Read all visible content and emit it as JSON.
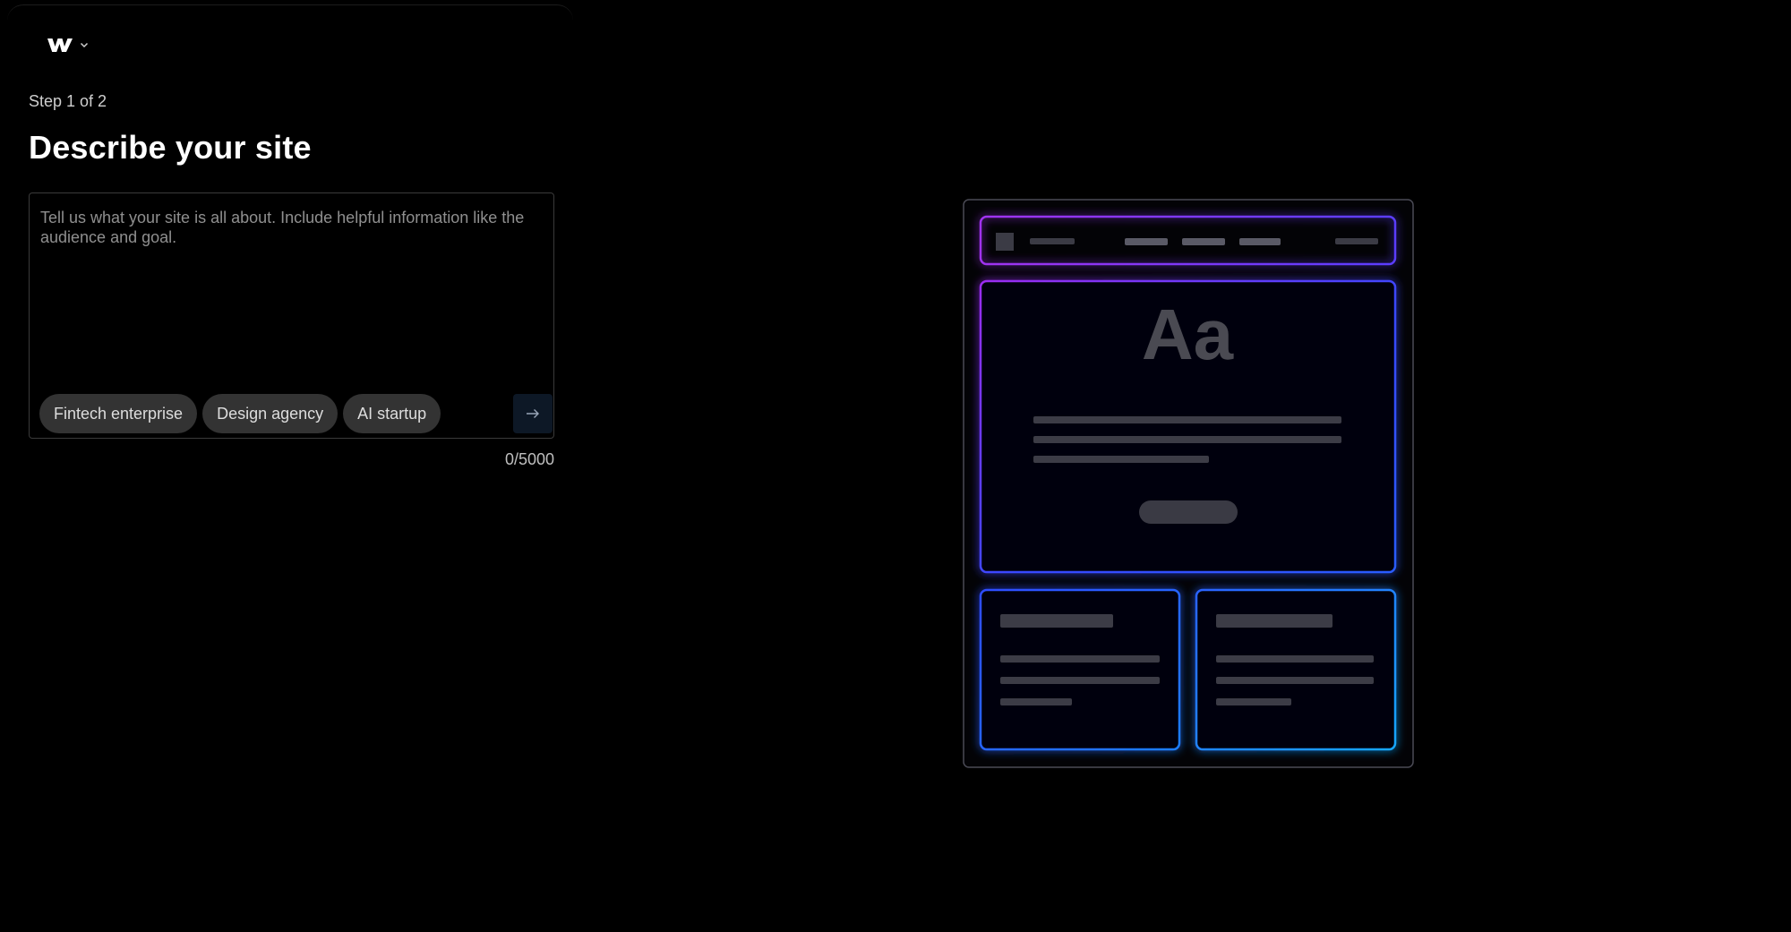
{
  "header": {
    "logo_icon": "webflow-logo-icon",
    "menu_icon": "chevron-down-icon"
  },
  "form": {
    "step": "Step 1 of 2",
    "title": "Describe your site",
    "prompt_placeholder": "Tell us what your site is all about. Include helpful information like the audience and goal.",
    "prompt_value": "",
    "suggestions": [
      {
        "label": "Fintech enterprise"
      },
      {
        "label": "Design agency"
      },
      {
        "label": "AI startup"
      }
    ],
    "submit_icon": "arrow-right-icon",
    "char_count": "0/5000"
  },
  "illustration": {
    "hero_text": "Aa"
  },
  "colors": {
    "background": "#000000",
    "chip_bg": "#333333",
    "glow_purple": "#9b2cf0",
    "glow_blue": "#2f4cff",
    "glow_cyan": "#1ea0ff",
    "placeholder_text": "#8f8f8f"
  }
}
